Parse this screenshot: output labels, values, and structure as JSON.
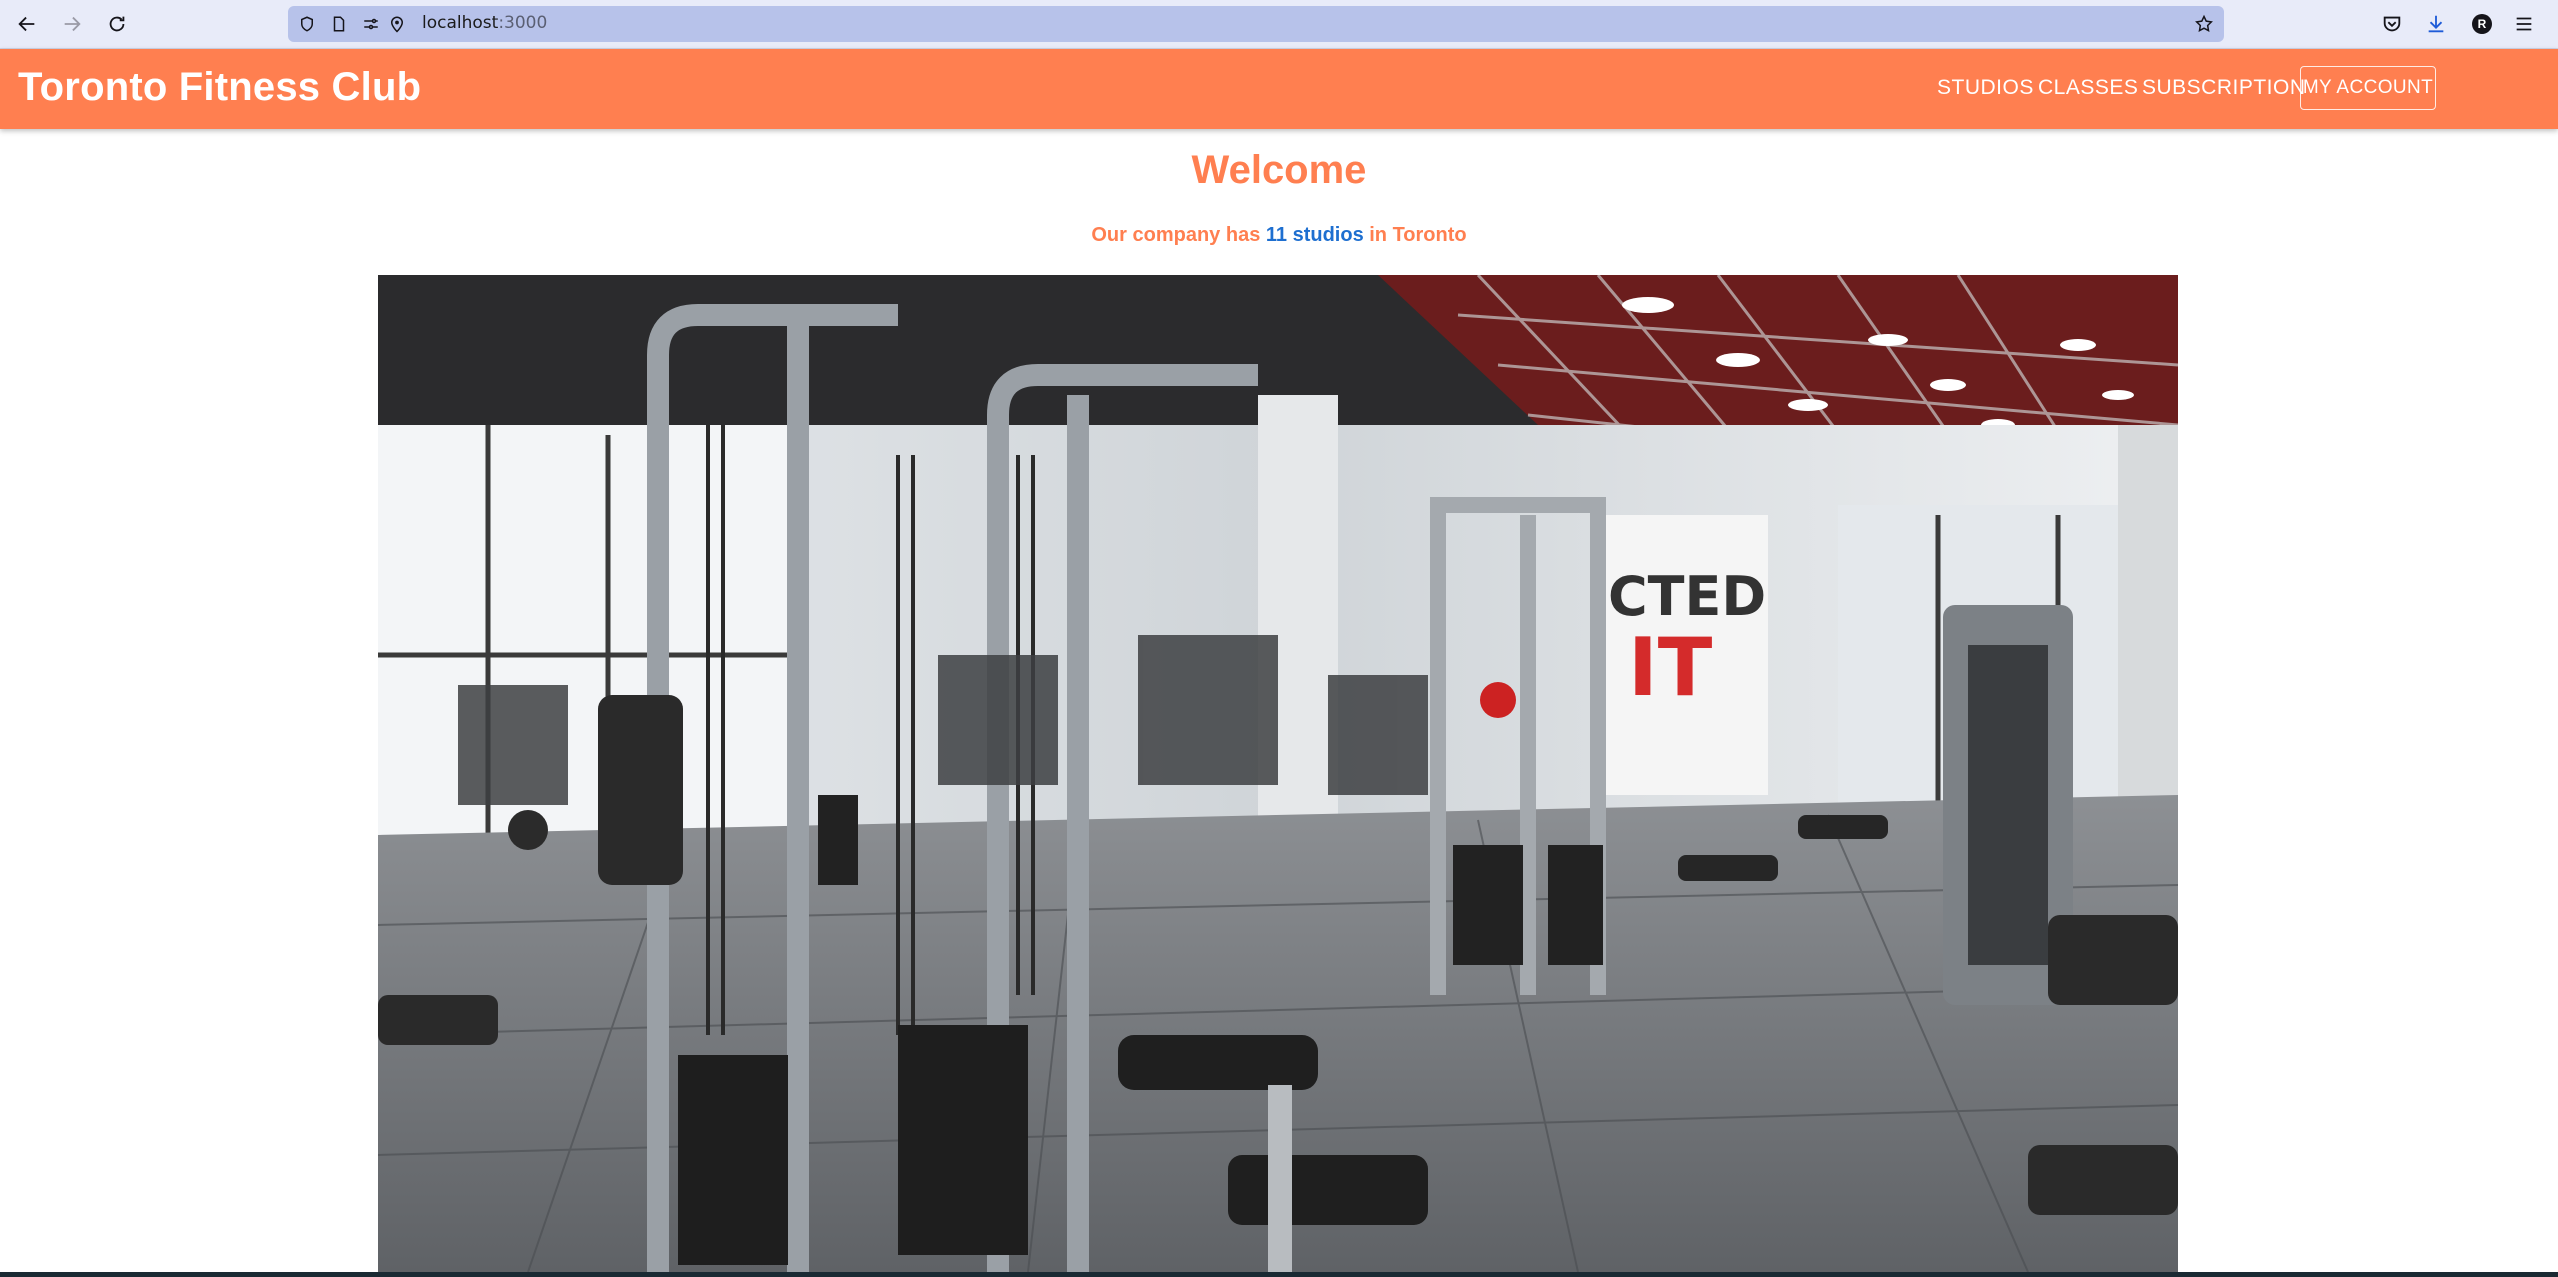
{
  "browser": {
    "url_host": "localhost",
    "url_port": ":3000",
    "profile_initial": "R"
  },
  "header": {
    "brand": "Toronto Fitness Club",
    "nav": [
      "STUDIOS",
      "CLASSES",
      "SUBSCRIPTION"
    ],
    "account_label": "MY ACCOUNT"
  },
  "main": {
    "title": "Welcome",
    "subtitle_prefix": "Our company has ",
    "subtitle_link": "11 studios",
    "subtitle_suffix": " in Toronto"
  },
  "colors": {
    "brand": "#ff7f50",
    "link": "#1e6fd0"
  }
}
